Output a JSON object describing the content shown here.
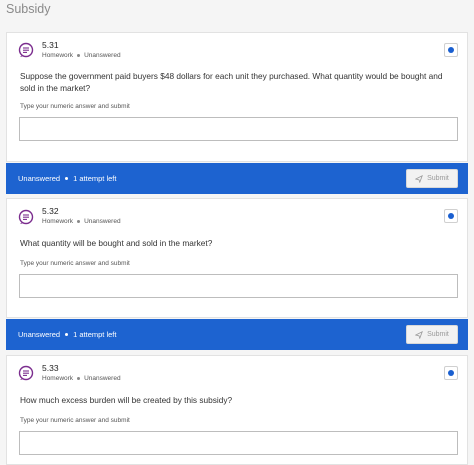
{
  "section": {
    "title": "Subsidy"
  },
  "questions": [
    {
      "number": "5.31",
      "type": "Homework",
      "state": "Unanswered",
      "text": "Suppose the government paid buyers $48 dollars for each unit they purchased. What quantity would be bought and sold in the market?",
      "hint": "Type your numeric answer and submit",
      "answer": "",
      "status": "Unanswered",
      "attempts": "1 attempt left",
      "submit_label": "Submit"
    },
    {
      "number": "5.32",
      "type": "Homework",
      "state": "Unanswered",
      "text": "What quantity will be bought and sold in the market?",
      "hint": "Type your numeric answer and submit",
      "answer": "",
      "status": "Unanswered",
      "attempts": "1 attempt left",
      "submit_label": "Submit"
    },
    {
      "number": "5.33",
      "type": "Homework",
      "state": "Unanswered",
      "text": "How much excess burden will be created by this subsidy?",
      "hint": "Type your numeric answer and submit",
      "answer": ""
    }
  ],
  "colors": {
    "accent": "#1d63d0",
    "icon": "#7b2d8e"
  }
}
